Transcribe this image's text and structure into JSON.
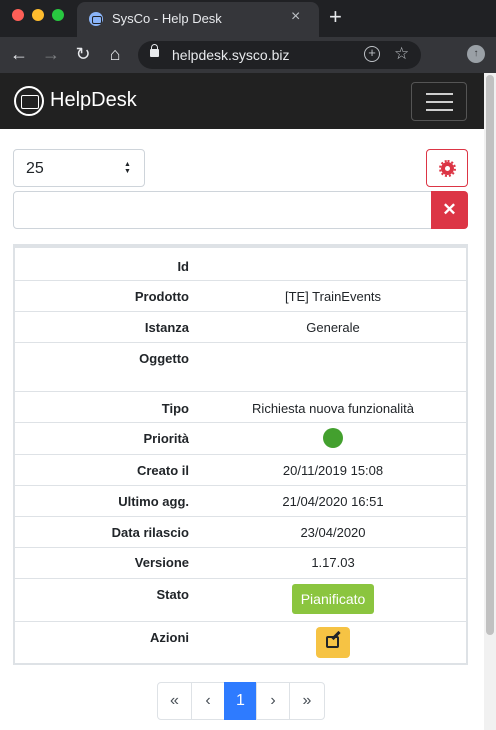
{
  "browser": {
    "tab_title": "SysCo - Help Desk",
    "tab_close": "×",
    "new_tab": "+",
    "url": "helpdesk.sysco.biz"
  },
  "app": {
    "brand": "HelpDesk"
  },
  "controls": {
    "page_size": "25",
    "search_value": "",
    "clear_label": "✕"
  },
  "details": [
    {
      "label": "Id",
      "value": ""
    },
    {
      "label": "Prodotto",
      "value": "[TE] TrainEvents"
    },
    {
      "label": "Istanza",
      "value": "Generale"
    },
    {
      "label": "Oggetto",
      "value": ""
    },
    {
      "label": "Tipo",
      "value": "Richiesta nuova funzionalità"
    },
    {
      "label": "Priorità",
      "value": "",
      "indicator_color": "#43a02e"
    },
    {
      "label": "Creato il",
      "value": "20/11/2019 15:08"
    },
    {
      "label": "Ultimo agg.",
      "value": "21/04/2020 16:51"
    },
    {
      "label": "Data rilascio",
      "value": "23/04/2020"
    },
    {
      "label": "Versione",
      "value": "1.17.03"
    },
    {
      "label": "Stato",
      "value": "Pianificato",
      "badge_color": "#8bc53f"
    },
    {
      "label": "Azioni",
      "value": "",
      "action_icon": "edit-icon",
      "action_color": "#f6c344"
    }
  ],
  "pagination": {
    "first": "«",
    "prev": "‹",
    "current": "1",
    "next": "›",
    "last": "»"
  }
}
